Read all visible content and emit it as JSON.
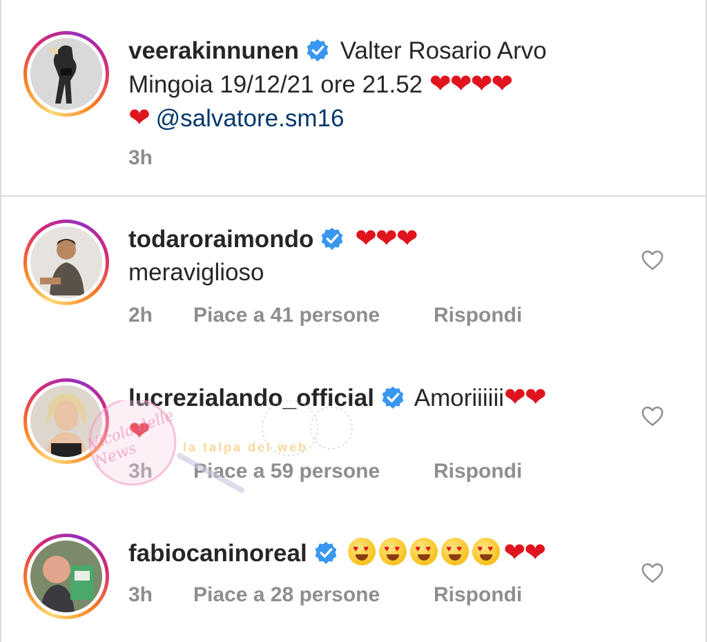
{
  "post": {
    "username": "veerakinnunen",
    "caption_line1": "Valter Rosario Arvo",
    "caption_line2": "Mingoia 19/12/21 ore 21.52",
    "hearts_line2": "❤❤❤❤",
    "hearts_line3": "❤",
    "mention": "@salvatore.sm16",
    "time": "3h"
  },
  "comments": [
    {
      "username": "todaroraimondo",
      "text_inline": "❤❤❤",
      "text_line2": "meraviglioso",
      "time": "2h",
      "likes": "Piace a 41 persone",
      "reply": "Rispondi"
    },
    {
      "username": "lucrezialando_official",
      "text_inline": "Amoriiiiii",
      "hearts_inline": "❤❤",
      "text_line2": "❤",
      "time": "3h",
      "likes": "Piace a 59 persone",
      "reply": "Rispondi"
    },
    {
      "username": "fabiocaninoreal",
      "emoji_count": 5,
      "hearts_inline": "❤❤",
      "time": "3h",
      "likes": "Piace a 28 persone",
      "reply": "Rispondi"
    }
  ],
  "watermark": {
    "text1": "Vicolo delle News",
    "text2": "la talpa del web"
  },
  "colors": {
    "verified": "#3897f0",
    "heart": "#e0141e",
    "mention": "#00376b",
    "meta": "#8e8e8e"
  }
}
